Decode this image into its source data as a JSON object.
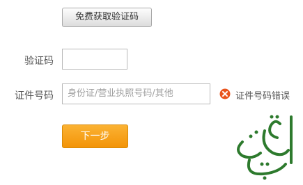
{
  "form": {
    "get_code_button": "免费获取验证码",
    "verification_label": "验证码",
    "verification_value": "",
    "id_label": "证件号码",
    "id_placeholder": "身份证/营业执照号码/其他",
    "error_text": "证件号码错误",
    "next_button": "下一步"
  },
  "colors": {
    "accent_button": "#f39408",
    "error_icon": "#e64a19"
  },
  "icons": {
    "error": "error-icon"
  },
  "watermark": {
    "text": "ثاليري"
  }
}
